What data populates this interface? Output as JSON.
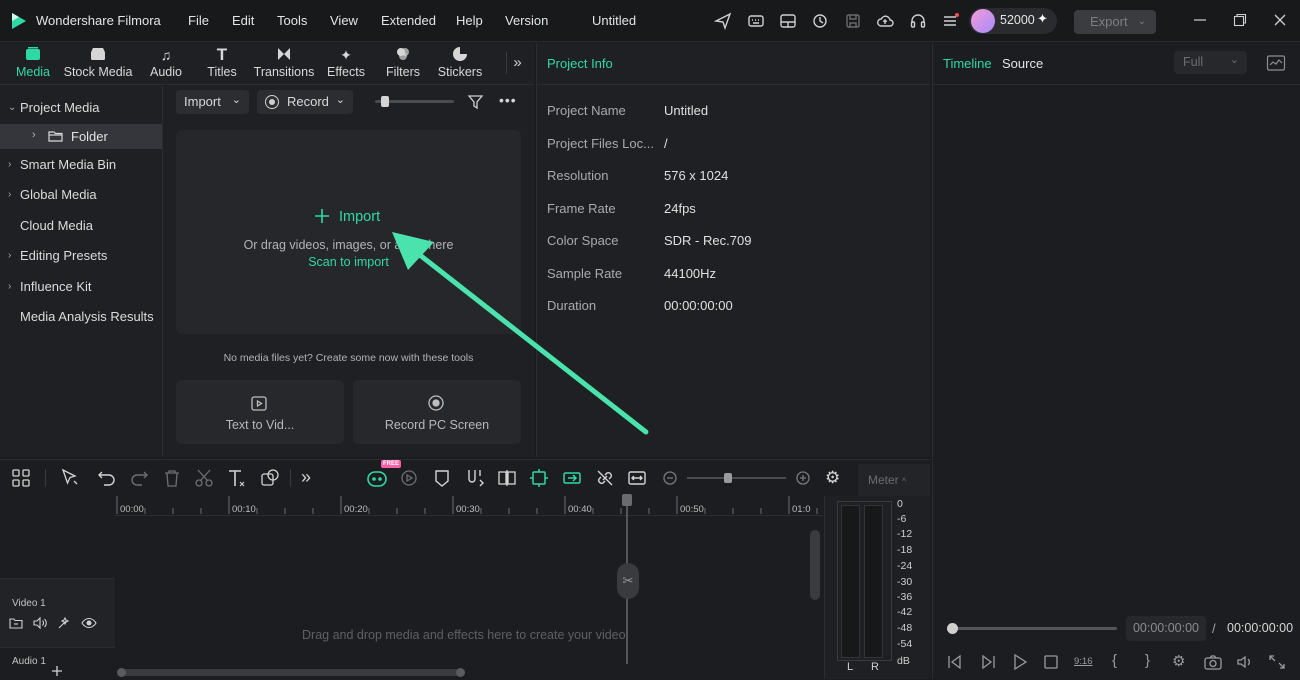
{
  "app": {
    "name": "Wondershare Filmora",
    "project_title": "Untitled",
    "credits": "52000",
    "export_label": "Export"
  },
  "menu": [
    "File",
    "Edit",
    "Tools",
    "View",
    "Extended",
    "Help",
    "Version"
  ],
  "nav_tabs": [
    {
      "label": "Media",
      "icon": "media-icon"
    },
    {
      "label": "Stock Media",
      "icon": "stock-media-icon"
    },
    {
      "label": "Audio",
      "icon": "audio-icon"
    },
    {
      "label": "Titles",
      "icon": "titles-icon"
    },
    {
      "label": "Transitions",
      "icon": "transitions-icon"
    },
    {
      "label": "Effects",
      "icon": "effects-icon"
    },
    {
      "label": "Filters",
      "icon": "filters-icon"
    },
    {
      "label": "Stickers",
      "icon": "stickers-icon"
    }
  ],
  "sidebar": {
    "project_media": "Project Media",
    "folder": "Folder",
    "items": [
      "Smart Media Bin",
      "Global Media",
      "Cloud Media",
      "Editing Presets",
      "Influence Kit",
      "Media Analysis Results"
    ]
  },
  "media_toolbar": {
    "import_label": "Import",
    "record_label": "Record"
  },
  "import_area": {
    "title": "Import",
    "hint": "Or drag videos, images, or audio here",
    "scan": "Scan to import"
  },
  "tools": {
    "hint": "No media files yet? Create some now with these tools",
    "text_to_video": "Text to Vid...",
    "record_screen": "Record PC Screen"
  },
  "project_info": {
    "title": "Project Info",
    "rows": [
      {
        "k": "Project Name",
        "v": "Untitled"
      },
      {
        "k": "Project Files Loc...",
        "v": "/"
      },
      {
        "k": "Resolution",
        "v": "576 x 1024"
      },
      {
        "k": "Frame Rate",
        "v": "24fps"
      },
      {
        "k": "Color Space",
        "v": "SDR - Rec.709"
      },
      {
        "k": "Sample Rate",
        "v": "44100Hz"
      },
      {
        "k": "Duration",
        "v": "00:00:00:00"
      }
    ]
  },
  "player": {
    "tab_timeline": "Timeline",
    "tab_source": "Source",
    "quality": "Full",
    "current_time": "00:00:00:00",
    "total_time": "00:00:00:00",
    "separator": "/"
  },
  "timeline": {
    "meter_label": "Meter",
    "free_badge": "FREE",
    "ticks": [
      "00:00",
      "00:10",
      "00:20",
      "00:30",
      "00:40",
      "00:50",
      "01:0"
    ],
    "video_track": "Video 1",
    "audio_track": "Audio 1",
    "drop_hint": "Drag and drop media and effects here to create your video.",
    "meter_scale": [
      "0",
      "-6",
      "-12",
      "-18",
      "-24",
      "-30",
      "-36",
      "-42",
      "-48",
      "-54",
      "dB"
    ],
    "meter_l": "L",
    "meter_r": "R"
  },
  "colors": {
    "accent": "#2fd9a6",
    "arrow": "#4be3ad",
    "bg": "#1b1c1f",
    "panel": "#1f2023"
  }
}
